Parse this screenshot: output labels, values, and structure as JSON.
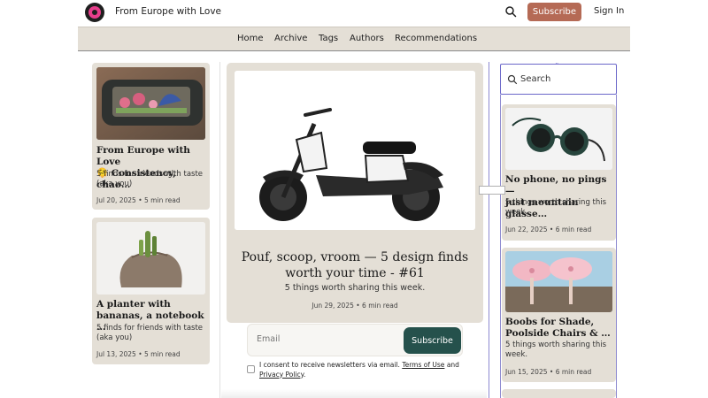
{
  "header": {
    "site_title": "From Europe with Love",
    "subscribe_label": "Subscribe",
    "signin_label": "Sign In"
  },
  "nav": {
    "items": [
      "Home",
      "Archive",
      "Tags",
      "Authors",
      "Recommendations"
    ]
  },
  "left_posts": [
    {
      "title_line1": "From Europe with Love",
      "title_line2": "🫠 Consistency, chao…",
      "subtitle_line1": "5 finds for friends with taste",
      "subtitle_line2": "(aka you)",
      "meta": "Jul 20, 2025 • 5 min read"
    },
    {
      "title_line1": "A planter with",
      "title_line2": "bananas, a notebook …",
      "subtitle_line1": "5 finds for friends with taste",
      "subtitle_line2": "(aka you)",
      "meta": "Jul 13, 2025 • 5 min read"
    }
  ],
  "feature": {
    "title_line1": "Pouf, scoop, vroom — 5 design finds",
    "title_line2": "worth your time - #61",
    "subtitle": "5 things worth sharing this week.",
    "meta": "Jun 29, 2025 • 6 min read"
  },
  "newsletter": {
    "email_placeholder": "Email",
    "subscribe_label": "Subscribe",
    "consent_prefix": "I consent to receive newsletters via email.",
    "terms_label": "Terms of Use",
    "and_label": "and",
    "privacy_label": "Privacy Policy",
    "period": "."
  },
  "search": {
    "placeholder": "Search"
  },
  "right_posts": [
    {
      "title_line1": "No phone, no pings —",
      "title_line2": "just mountain glasse…",
      "subtitle_line1": "5 things worth sharing this",
      "subtitle_line2": "week.",
      "meta": "Jun 22, 2025 • 6 min read"
    },
    {
      "title_line1": "Boobs for Shade,",
      "title_line2": "Poolside Chairs & …",
      "subtitle_line1": "5 things worth sharing this",
      "subtitle_line2": "week.",
      "meta": "Jun 15, 2025 • 6 min read"
    }
  ],
  "colors": {
    "accent_subscribe": "#b56a55",
    "newsletter_button": "#25514c",
    "card_background": "#e4dfd6",
    "selection_outline": "#6b67c9"
  },
  "icons": {
    "logo": "pink-ring-logo-icon",
    "header_search": "search-icon",
    "search_box": "search-icon"
  }
}
